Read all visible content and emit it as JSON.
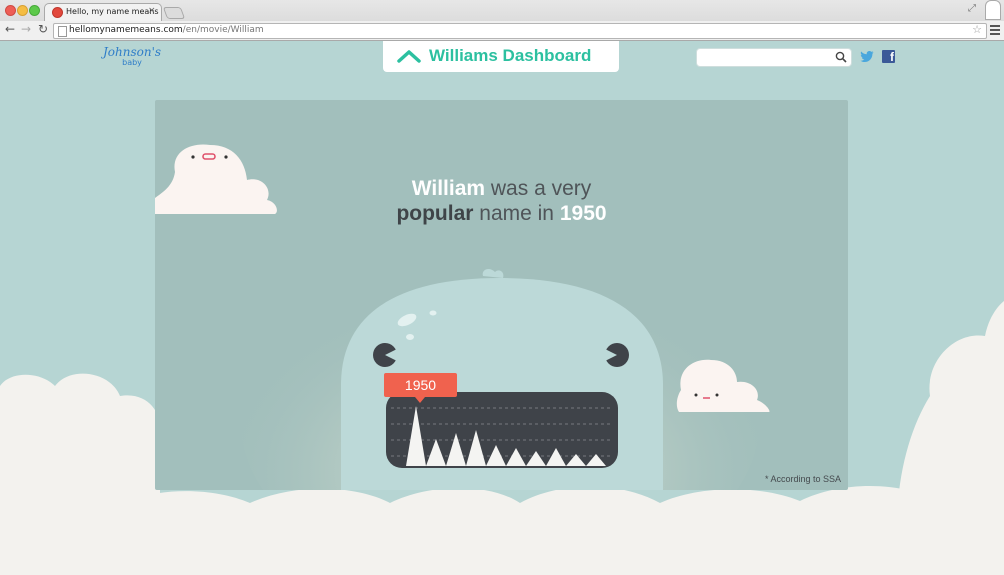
{
  "browser": {
    "tab_title": "Hello, my name means",
    "url_domain": "hellomynamemeans.com",
    "url_path": "/en/movie/William"
  },
  "header": {
    "logo_main": "Johnson's",
    "logo_sub": "baby",
    "title": "Williams Dashboard",
    "search_placeholder": ""
  },
  "hero": {
    "name": "William",
    "text_1": "was a very",
    "word_bold": "popular",
    "text_2": "name in",
    "year": "1950"
  },
  "chart": {
    "selected_year": "1950",
    "peak_heights": [
      1.0,
      0.45,
      0.55,
      0.6,
      0.35,
      0.3,
      0.25,
      0.3,
      0.2,
      0.2
    ]
  },
  "footnote": "* According to SSA",
  "colors": {
    "page_bg": "#b6d5d3",
    "panel_bg": "#a2bfbc",
    "accent": "#2cc0a0",
    "tag": "#f0624e",
    "monster": "#bcd9d8",
    "mouth": "#3f4349"
  }
}
